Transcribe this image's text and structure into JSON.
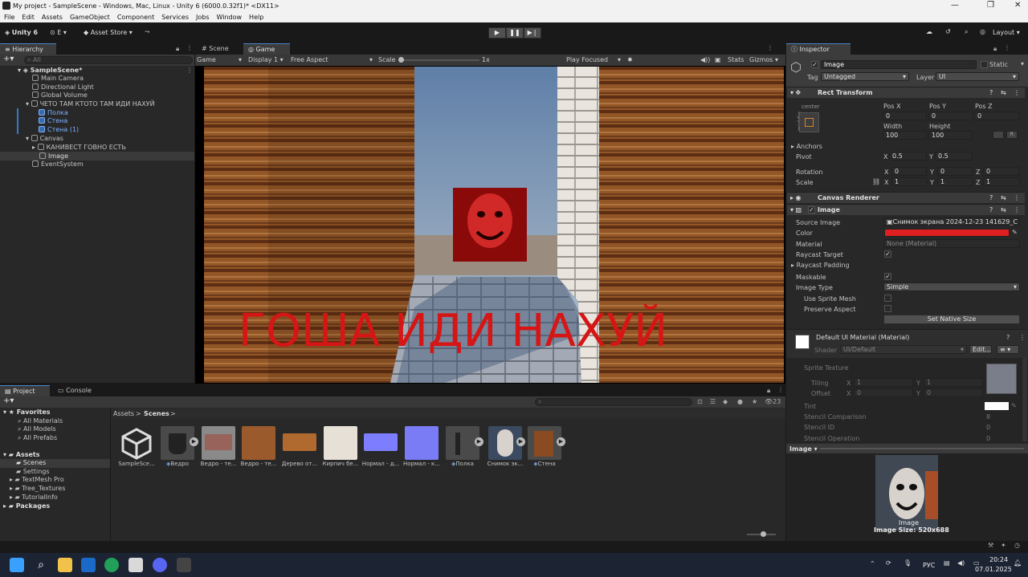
{
  "window": {
    "title": "My project - SampleScene - Windows, Mac, Linux - Unity 6 (6000.0.32f1)* <DX11>"
  },
  "menu": [
    "File",
    "Edit",
    "Assets",
    "GameObject",
    "Component",
    "Services",
    "Jobs",
    "Window",
    "Help"
  ],
  "toolbar": {
    "unity": "Unity 6",
    "account": "E",
    "asset_store": "Asset Store",
    "layout": "Layout"
  },
  "hierarchy": {
    "tab": "Hierarchy",
    "search_placeholder": "All",
    "items": [
      {
        "label": "SampleScene*"
      },
      {
        "label": "Main Camera"
      },
      {
        "label": "Directional Light"
      },
      {
        "label": "Global Volume"
      },
      {
        "label": "ЧЕТО ТАМ КТОТО ТАМ ИДИ НАХУЙ"
      },
      {
        "label": "Полка"
      },
      {
        "label": "Стена"
      },
      {
        "label": "Стена (1)"
      },
      {
        "label": "Canvas"
      },
      {
        "label": "КАНИВЕСТ ГОВНО ЕСТЬ"
      },
      {
        "label": "Image"
      },
      {
        "label": "EventSystem"
      }
    ]
  },
  "scene_tabs": {
    "scene": "Scene",
    "game": "Game"
  },
  "game_bar": {
    "mode": "Game",
    "display": "Display 1",
    "aspect": "Free Aspect",
    "scale_label": "Scale",
    "scale_value": "1x",
    "play_focused": "Play Focused",
    "stats": "Stats",
    "gizmos": "Gizmos"
  },
  "game_view": {
    "overlay_text": "ГОША ИДИ НАХУЙ"
  },
  "inspector": {
    "tab": "Inspector",
    "name": "Image",
    "static_label": "Static",
    "tag_label": "Tag",
    "tag_value": "Untagged",
    "layer_label": "Layer",
    "layer_value": "UI",
    "rect_transform": {
      "title": "Rect Transform",
      "anchor_h": "center",
      "anchor_v": "middle",
      "pos_x_label": "Pos X",
      "pos_y_label": "Pos Y",
      "pos_z_label": "Pos Z",
      "pos_x": "0",
      "pos_y": "0",
      "pos_z": "0",
      "width_label": "Width",
      "height_label": "Height",
      "width": "100",
      "height": "100",
      "anchors": "Anchors",
      "pivot_label": "Pivot",
      "pivot_x": "0.5",
      "pivot_y": "0.5",
      "rotation_label": "Rotation",
      "rot_x": "0",
      "rot_y": "0",
      "rot_z": "0",
      "scale_label": "Scale",
      "scale_x": "1",
      "scale_y": "1",
      "scale_z": "1",
      "axis_x": "X",
      "axis_y": "Y",
      "axis_z": "Z",
      "btn_r": "R"
    },
    "canvas_renderer": {
      "title": "Canvas Renderer"
    },
    "image": {
      "title": "Image",
      "source_image_label": "Source Image",
      "source_image": "Снимок экрана 2024-12-23 141629_C",
      "color_label": "Color",
      "color": "#e02020",
      "material_label": "Material",
      "material": "None (Material)",
      "raycast_target_label": "Raycast Target",
      "raycast_padding_label": "Raycast Padding",
      "maskable_label": "Maskable",
      "image_type_label": "Image Type",
      "image_type": "Simple",
      "use_sprite_mesh_label": "Use Sprite Mesh",
      "preserve_aspect_label": "Preserve Aspect",
      "set_native_size": "Set Native Size"
    },
    "material_block": {
      "title": "Default UI Material (Material)",
      "shader_label": "Shader",
      "shader": "UI/Default",
      "edit": "Edit...",
      "sprite_texture": "Sprite Texture",
      "tiling": "Tiling",
      "tiling_x": "1",
      "tiling_y": "1",
      "offset": "Offset",
      "offset_x": "0",
      "offset_y": "0",
      "tint": "Tint",
      "stencil_comparison": "Stencil Comparison",
      "stencil_comparison_value": "8",
      "stencil_id": "Stencil ID",
      "stencil_id_value": "0",
      "stencil_operation": "Stencil Operation",
      "stencil_operation_value": "0"
    },
    "preview": {
      "header": "Image",
      "caption": "Image",
      "size": "Image Size: 520x688"
    }
  },
  "project": {
    "tab": "Project",
    "console_tab": "Console",
    "breadcrumb_root": "Assets",
    "breadcrumb_current": "Scenes",
    "count": "23",
    "tree": [
      {
        "label": "Favorites"
      },
      {
        "label": "All Materials"
      },
      {
        "label": "All Models"
      },
      {
        "label": "All Prefabs"
      },
      {
        "label": "Assets"
      },
      {
        "label": "Scenes"
      },
      {
        "label": "Settings"
      },
      {
        "label": "TextMesh Pro"
      },
      {
        "label": "Tree_Textures"
      },
      {
        "label": "TutorialInfo"
      },
      {
        "label": "Packages"
      }
    ],
    "assets": [
      {
        "label": "SampleSce..."
      },
      {
        "label": "Ведро"
      },
      {
        "label": "Ведро - те..."
      },
      {
        "label": "Ведро - те..."
      },
      {
        "label": "Дерево от..."
      },
      {
        "label": "Кирпич бе..."
      },
      {
        "label": "Нормал - д..."
      },
      {
        "label": "Нормал - к..."
      },
      {
        "label": "Полка"
      },
      {
        "label": "Снимок эк..."
      },
      {
        "label": "Стена"
      }
    ]
  },
  "taskbar": {
    "lang": "РУС",
    "time": "20:24",
    "date": "07.01.2025"
  }
}
